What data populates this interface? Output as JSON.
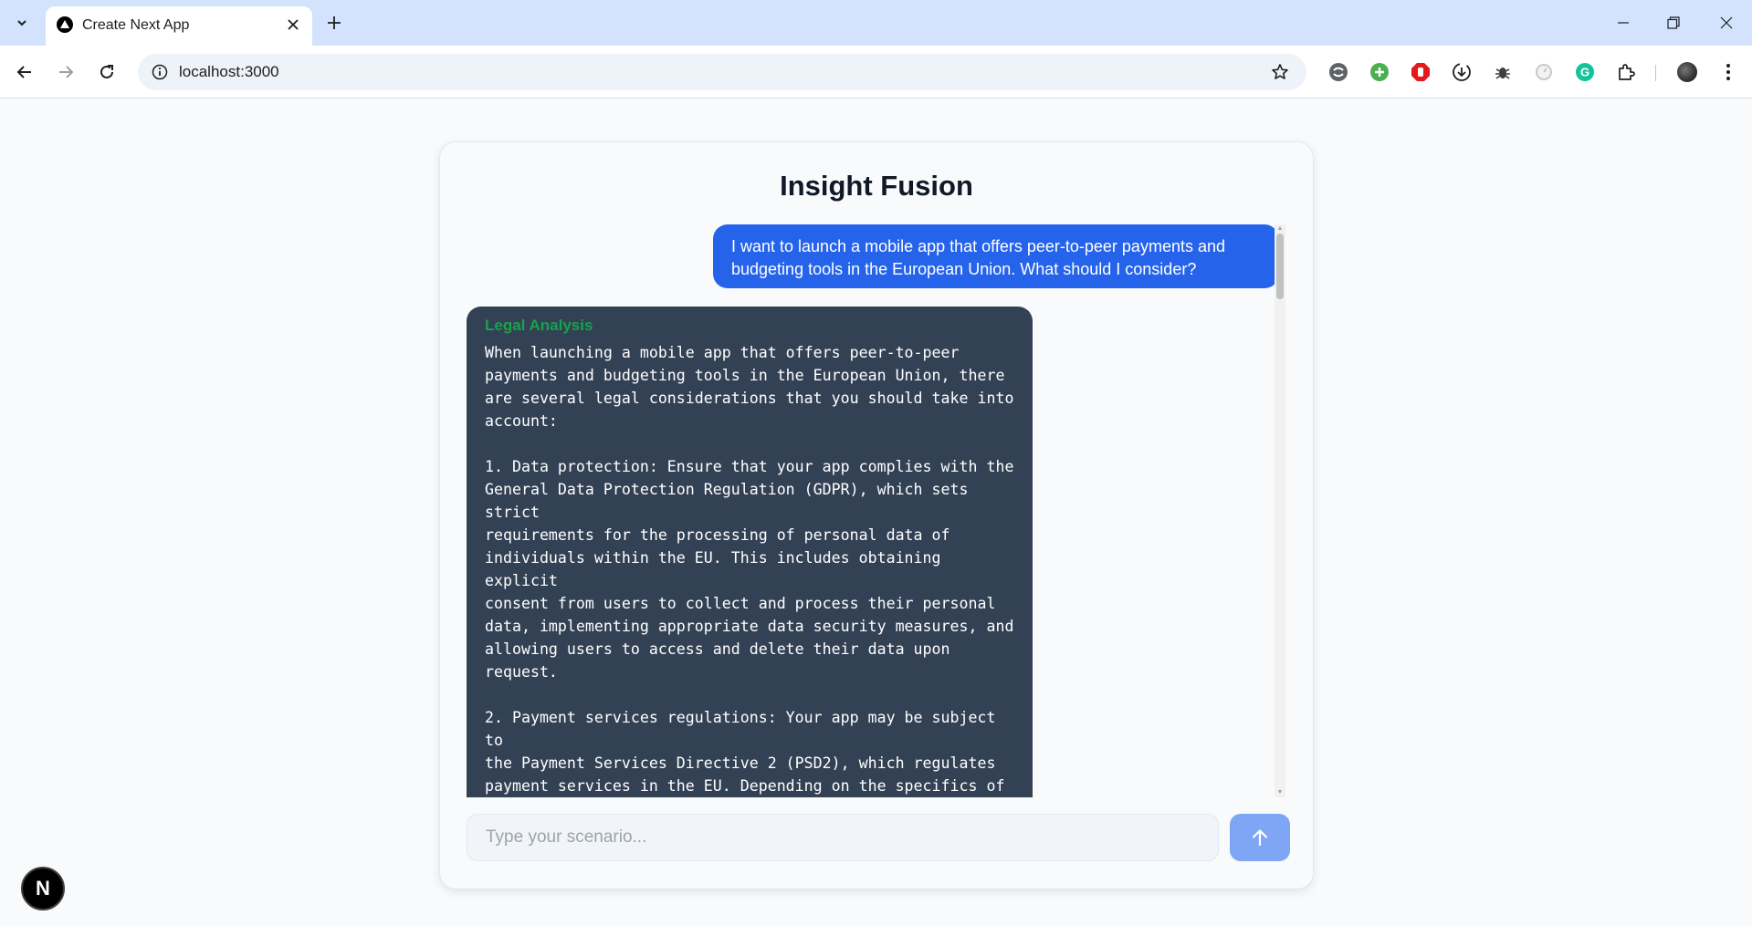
{
  "browser": {
    "tab_title": "Create Next App",
    "url": "localhost:3000"
  },
  "app": {
    "title": "Insight Fusion"
  },
  "chat": {
    "user_message": "I want to launch a mobile app that offers peer-to-peer payments and budgeting tools in the European Union. What should I consider?",
    "bot_label": "Legal Analysis",
    "bot_message": "When launching a mobile app that offers peer-to-peer\npayments and budgeting tools in the European Union, there\nare several legal considerations that you should take into\naccount:\n\n1. Data protection: Ensure that your app complies with the\nGeneral Data Protection Regulation (GDPR), which sets strict\nrequirements for the processing of personal data of\nindividuals within the EU. This includes obtaining explicit\nconsent from users to collect and process their personal\ndata, implementing appropriate data security measures, and\nallowing users to access and delete their data upon request.\n\n2. Payment services regulations: Your app may be subject to\nthe Payment Services Directive 2 (PSD2), which regulates\npayment services in the EU. Depending on the specifics of\nyour app, you may need to obtain a payment institution\nlicense or partner with a licensed payment service provider\nto facilitate peer-to-peer payments."
  },
  "input": {
    "placeholder": "Type your scenario..."
  },
  "badge": {
    "letter": "N"
  },
  "colors": {
    "user_bubble": "#2563eb",
    "bot_bubble": "#334155",
    "bot_label": "#16a34a",
    "send_button": "#7ea6f5"
  },
  "icons": {
    "send": "arrow-up-icon",
    "favicon": "nextjs-triangle-icon"
  }
}
